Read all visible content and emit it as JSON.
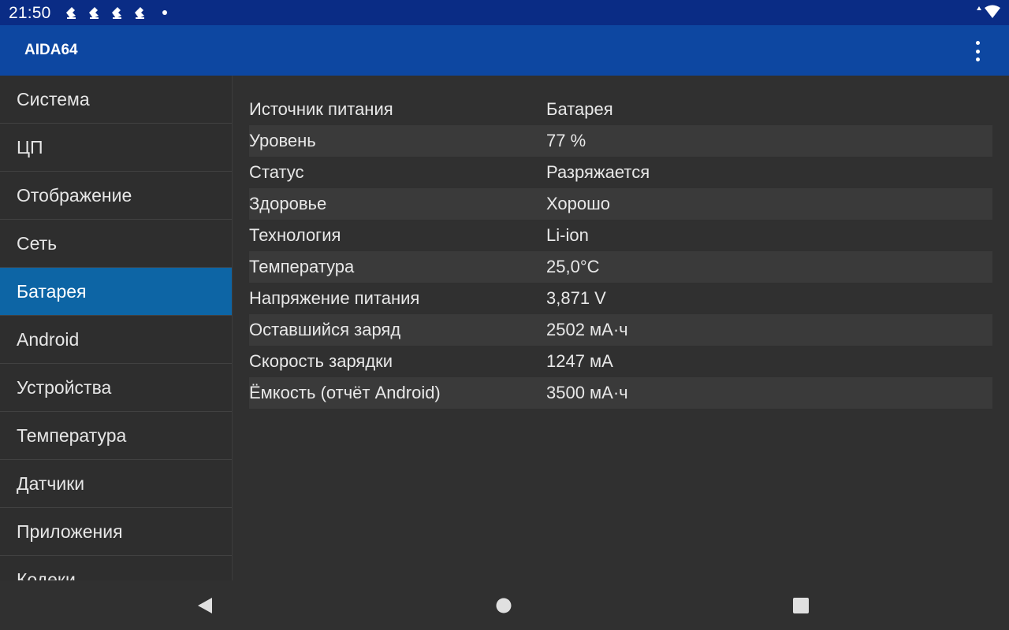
{
  "status_bar": {
    "time": "21:50",
    "icons": [
      "notification-icon",
      "notification-icon",
      "notification-icon",
      "notification-icon",
      "dot-icon",
      "data-arrows-icon",
      "wifi-icon"
    ]
  },
  "app_bar": {
    "title": "AIDA64",
    "menu_icon": "more-vert-icon"
  },
  "sidebar": {
    "items": [
      {
        "label": "Система"
      },
      {
        "label": "ЦП"
      },
      {
        "label": "Отображение"
      },
      {
        "label": "Сеть"
      },
      {
        "label": "Батарея",
        "active": true
      },
      {
        "label": "Android"
      },
      {
        "label": "Устройства"
      },
      {
        "label": "Температура"
      },
      {
        "label": "Датчики"
      },
      {
        "label": "Приложения"
      },
      {
        "label": "Кодеки"
      }
    ]
  },
  "battery": {
    "rows": [
      {
        "key": "Источник питания",
        "value": "Батарея"
      },
      {
        "key": "Уровень",
        "value": "77 %"
      },
      {
        "key": "Статус",
        "value": "Разряжается"
      },
      {
        "key": "Здоровье",
        "value": "Хорошо"
      },
      {
        "key": "Технология",
        "value": "Li-ion"
      },
      {
        "key": "Температура",
        "value": "25,0°C"
      },
      {
        "key": "Напряжение питания",
        "value": "3,871 V"
      },
      {
        "key": "Оставшийся заряд",
        "value": "2502 мА·ч"
      },
      {
        "key": "Скорость зарядки",
        "value": "1247 мА"
      },
      {
        "key": "Ёмкость (отчёт Android)",
        "value": "3500 мА·ч"
      }
    ]
  },
  "nav_bar": {
    "icons": [
      "back-icon",
      "home-icon",
      "recents-icon"
    ]
  },
  "colors": {
    "status_bar": "#0a2c85",
    "app_bar": "#0d47a1",
    "active_item": "#0d65a5",
    "background": "#303030"
  }
}
